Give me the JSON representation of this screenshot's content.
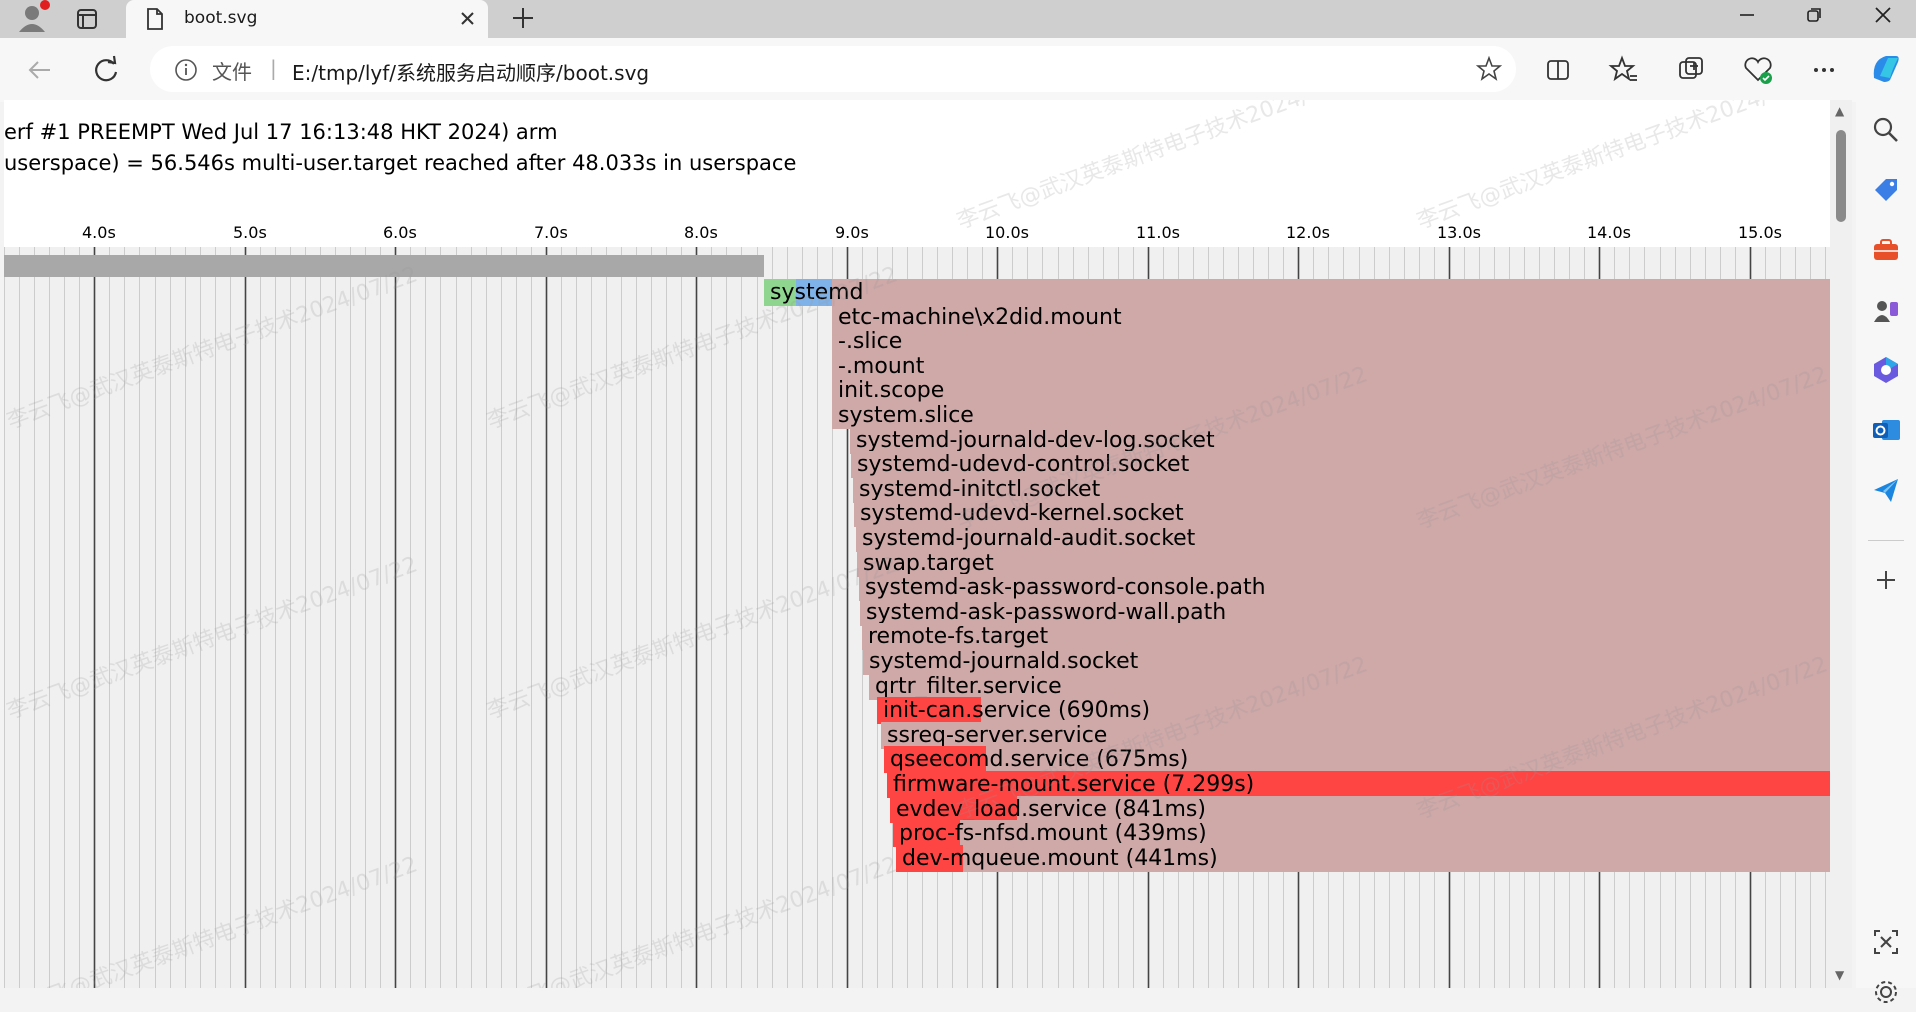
{
  "browser": {
    "tab_title": "boot.svg",
    "address_scheme_label": "文件",
    "address_separator": "|",
    "address_url": "E:/tmp/lyf/系统服务启动顺序/boot.svg",
    "icons": [
      "profile-icon",
      "tab-actions-icon",
      "file-icon",
      "close-icon",
      "new-tab-icon",
      "minimize-icon",
      "restore-icon",
      "window-close-icon",
      "back-icon",
      "refresh-icon",
      "info-icon",
      "favorite-star-icon",
      "split-screen-icon",
      "favorites-icon",
      "collections-icon",
      "browser-essentials-icon",
      "more-icon",
      "copilot-icon"
    ]
  },
  "sidebar": {
    "icons": [
      "search-icon",
      "shopping-tag-icon",
      "tools-icon",
      "games-icon",
      "microsoft365-icon",
      "outlook-icon",
      "send-icon",
      "add-icon",
      "screenshot-icon",
      "settings-icon"
    ]
  },
  "page": {
    "header_line1": "erf #1 PREEMPT Wed Jul 17 16:13:48 HKT 2024) arm",
    "header_line2": "userspace) = 56.546s multi-user.target reached after 48.033s in userspace",
    "watermark_text": "李云飞@武汉英泰斯特电子技术2024/07/22",
    "colors": {
      "active": "#cfa8a8",
      "activating": "#ff4444",
      "kernel": "#a8a8a8",
      "systemd_green": "#8fd48f",
      "systemd_blue": "#7fb2e8",
      "grid_bg": "#f0f0f0",
      "grid_major": "#444444",
      "grid_minor": "#cccccc"
    }
  },
  "chart_data": {
    "type": "gantt",
    "x_ticks": [
      "4.0s",
      "5.0s",
      "6.0s",
      "7.0s",
      "8.0s",
      "9.0s",
      "10.0s",
      "11.0s",
      "12.0s",
      "13.0s",
      "14.0s",
      "15.0s"
    ],
    "xlim": [
      3.4,
      15.55
    ],
    "kernel_end": 8.45,
    "units": [
      {
        "name": "systemd",
        "label": "systemd",
        "start": 8.45,
        "end": 15.55,
        "activating_end": null,
        "color": "systemd"
      },
      {
        "name": "etc-machine-id-mount",
        "label": "etc-machine\\x2did.mount",
        "start": 8.9,
        "end": 15.55,
        "activating_end": null
      },
      {
        "name": "slice",
        "label": "-.slice",
        "start": 8.9,
        "end": 15.55,
        "activating_end": null
      },
      {
        "name": "root-mount",
        "label": "-.mount",
        "start": 8.9,
        "end": 15.55,
        "activating_end": null
      },
      {
        "name": "init-scope",
        "label": "init.scope",
        "start": 8.9,
        "end": 15.55,
        "activating_end": null
      },
      {
        "name": "system-slice",
        "label": "system.slice",
        "start": 8.9,
        "end": 15.55,
        "activating_end": null
      },
      {
        "name": "journald-dev-log-socket",
        "label": "systemd-journald-dev-log.socket",
        "start": 9.02,
        "end": 15.55,
        "activating_end": null
      },
      {
        "name": "udevd-control-socket",
        "label": "systemd-udevd-control.socket",
        "start": 9.03,
        "end": 15.55,
        "activating_end": null
      },
      {
        "name": "initctl-socket",
        "label": "systemd-initctl.socket",
        "start": 9.04,
        "end": 15.55,
        "activating_end": null
      },
      {
        "name": "udevd-kernel-socket",
        "label": "systemd-udevd-kernel.socket",
        "start": 9.05,
        "end": 15.55,
        "activating_end": null
      },
      {
        "name": "journald-audit-socket",
        "label": "systemd-journald-audit.socket",
        "start": 9.06,
        "end": 15.55,
        "activating_end": null
      },
      {
        "name": "swap-target",
        "label": "swap.target",
        "start": 9.07,
        "end": 15.55,
        "activating_end": null
      },
      {
        "name": "ask-password-console-path",
        "label": "systemd-ask-password-console.path",
        "start": 9.08,
        "end": 15.55,
        "activating_end": null
      },
      {
        "name": "ask-password-wall-path",
        "label": "systemd-ask-password-wall.path",
        "start": 9.09,
        "end": 15.55,
        "activating_end": null
      },
      {
        "name": "remote-fs-target",
        "label": "remote-fs.target",
        "start": 9.1,
        "end": 15.55,
        "activating_end": null
      },
      {
        "name": "journald-socket",
        "label": "systemd-journald.socket",
        "start": 9.11,
        "end": 15.55,
        "activating_end": null
      },
      {
        "name": "qrtr-filter-service",
        "label": "qrtr_filter.service",
        "start": 9.15,
        "end": 15.55,
        "activating_end": null
      },
      {
        "name": "init-can-service",
        "label": "init-can.service (690ms)",
        "start": 9.2,
        "end": 15.55,
        "activating_end": 9.89
      },
      {
        "name": "ssreq-server-service",
        "label": "ssreq-server.service",
        "start": 9.23,
        "end": 15.55,
        "activating_end": null
      },
      {
        "name": "qseecomd-service",
        "label": "qseecomd.service (675ms)",
        "start": 9.25,
        "end": 15.55,
        "activating_end": 9.925
      },
      {
        "name": "firmware-mount-service",
        "label": "firmware-mount.service (7.299s)",
        "start": 9.27,
        "end": 15.55,
        "activating_end": 15.55
      },
      {
        "name": "evdev-load-service",
        "label": "evdev_load.service (841ms)",
        "start": 9.29,
        "end": 15.55,
        "activating_end": 10.13
      },
      {
        "name": "proc-fs-nfsd-mount",
        "label": "proc-fs-nfsd.mount (439ms)",
        "start": 9.31,
        "end": 15.55,
        "activating_end": 9.749
      },
      {
        "name": "dev-mqueue-mount",
        "label": "dev-mqueue.mount (441ms)",
        "start": 9.33,
        "end": 15.55,
        "activating_end": 9.771
      }
    ]
  }
}
